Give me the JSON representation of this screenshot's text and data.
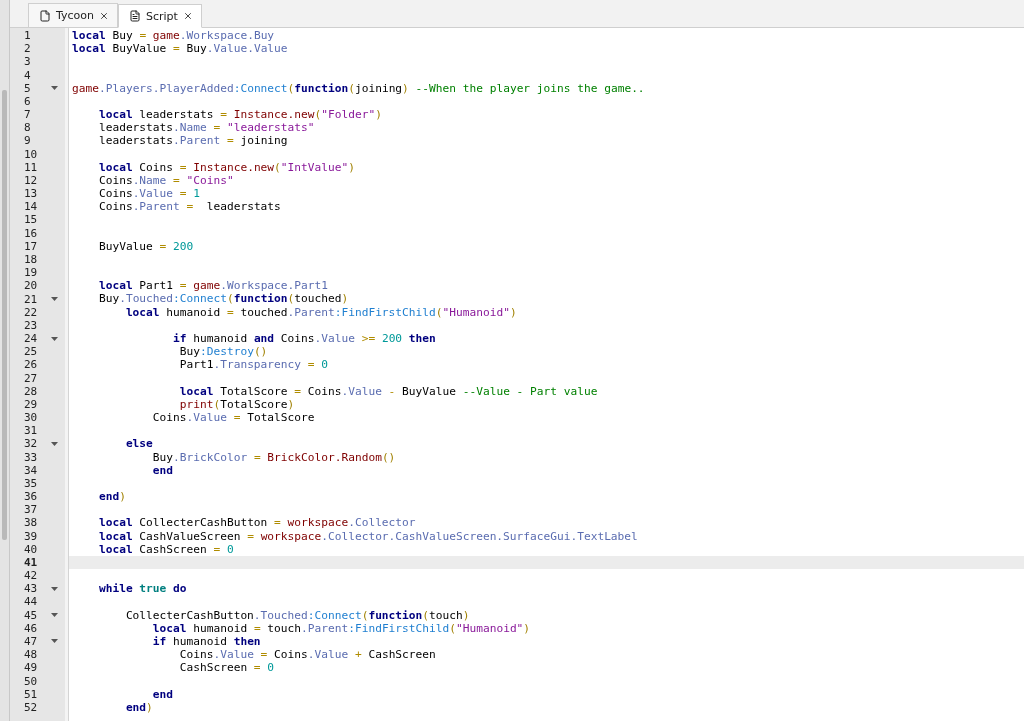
{
  "tabs": [
    {
      "label": "Tycoon",
      "kind": "place",
      "selected": false
    },
    {
      "label": "Script",
      "kind": "script",
      "selected": true
    }
  ],
  "lines": [
    {
      "number": "1",
      "fold": false,
      "current": false,
      "tokens": [
        {
          "kind": "keyword",
          "text": "local"
        },
        {
          "kind": "plain",
          "text": " Buy "
        },
        {
          "kind": "op",
          "text": "= "
        },
        {
          "kind": "global",
          "text": "game"
        },
        {
          "kind": "member",
          "text": ".Workspace.Buy"
        }
      ]
    },
    {
      "number": "2",
      "fold": false,
      "current": false,
      "tokens": [
        {
          "kind": "keyword",
          "text": "local"
        },
        {
          "kind": "plain",
          "text": " BuyValue "
        },
        {
          "kind": "op",
          "text": "="
        },
        {
          "kind": "plain",
          "text": " Buy"
        },
        {
          "kind": "member",
          "text": ".Value.Value"
        }
      ]
    },
    {
      "number": "3",
      "fold": false,
      "current": false
    },
    {
      "number": "4",
      "fold": false,
      "current": false
    },
    {
      "number": "5",
      "fold": true,
      "current": false,
      "tokens": [
        {
          "kind": "global",
          "text": "game"
        },
        {
          "kind": "member",
          "text": ".Players.PlayerAdded"
        },
        {
          "kind": "method",
          "text": ":Connect"
        },
        {
          "kind": "paren",
          "text": "("
        },
        {
          "kind": "keyword",
          "text": "function"
        },
        {
          "kind": "paren",
          "text": "("
        },
        {
          "kind": "plain",
          "text": "joining"
        },
        {
          "kind": "paren",
          "text": ") "
        },
        {
          "kind": "comment",
          "text": "--When the player joins the game.."
        }
      ]
    },
    {
      "number": "6",
      "fold": false,
      "current": false
    },
    {
      "number": "7",
      "fold": false,
      "current": false,
      "tokens": [
        {
          "kind": "keyword",
          "text": "    local"
        },
        {
          "kind": "plain",
          "text": " leaderstats "
        },
        {
          "kind": "op",
          "text": "= "
        },
        {
          "kind": "global",
          "text": "Instance.new"
        },
        {
          "kind": "paren",
          "text": "("
        },
        {
          "kind": "string",
          "text": "\"Folder\""
        },
        {
          "kind": "paren",
          "text": ")"
        }
      ]
    },
    {
      "number": "8",
      "fold": false,
      "current": false,
      "tokens": [
        {
          "kind": "plain",
          "text": "    leaderstats"
        },
        {
          "kind": "member",
          "text": ".Name"
        },
        {
          "kind": "op",
          "text": " = "
        },
        {
          "kind": "string",
          "text": "\"leaderstats\""
        }
      ]
    },
    {
      "number": "9",
      "fold": false,
      "current": false,
      "tokens": [
        {
          "kind": "plain",
          "text": "    leaderstats"
        },
        {
          "kind": "member",
          "text": ".Parent"
        },
        {
          "kind": "op",
          "text": " ="
        },
        {
          "kind": "plain",
          "text": " joining"
        }
      ]
    },
    {
      "number": "10",
      "fold": false,
      "current": false
    },
    {
      "number": "11",
      "fold": false,
      "current": false,
      "tokens": [
        {
          "kind": "keyword",
          "text": "    local"
        },
        {
          "kind": "plain",
          "text": " Coins "
        },
        {
          "kind": "op",
          "text": "= "
        },
        {
          "kind": "global",
          "text": "Instance.new"
        },
        {
          "kind": "paren",
          "text": "("
        },
        {
          "kind": "string",
          "text": "\"IntValue\""
        },
        {
          "kind": "paren",
          "text": ")"
        }
      ]
    },
    {
      "number": "12",
      "fold": false,
      "current": false,
      "tokens": [
        {
          "kind": "plain",
          "text": "    Coins"
        },
        {
          "kind": "member",
          "text": ".Name"
        },
        {
          "kind": "op",
          "text": " = "
        },
        {
          "kind": "string",
          "text": "\"Coins\""
        }
      ]
    },
    {
      "number": "13",
      "fold": false,
      "current": false,
      "tokens": [
        {
          "kind": "plain",
          "text": "    Coins"
        },
        {
          "kind": "member",
          "text": ".Value"
        },
        {
          "kind": "op",
          "text": " = "
        },
        {
          "kind": "number",
          "text": "1"
        }
      ]
    },
    {
      "number": "14",
      "fold": false,
      "current": false,
      "tokens": [
        {
          "kind": "plain",
          "text": "    Coins"
        },
        {
          "kind": "member",
          "text": ".Parent"
        },
        {
          "kind": "op",
          "text": " ="
        },
        {
          "kind": "plain",
          "text": "  leaderstats"
        }
      ]
    },
    {
      "number": "15",
      "fold": false,
      "current": false
    },
    {
      "number": "16",
      "fold": false,
      "current": false
    },
    {
      "number": "17",
      "fold": false,
      "current": false,
      "tokens": [
        {
          "kind": "plain",
          "text": "    BuyValue "
        },
        {
          "kind": "op",
          "text": "= "
        },
        {
          "kind": "number",
          "text": "200"
        }
      ]
    },
    {
      "number": "18",
      "fold": false,
      "current": false
    },
    {
      "number": "19",
      "fold": false,
      "current": false
    },
    {
      "number": "20",
      "fold": false,
      "current": false,
      "tokens": [
        {
          "kind": "keyword",
          "text": "    local"
        },
        {
          "kind": "plain",
          "text": " Part1 "
        },
        {
          "kind": "op",
          "text": "= "
        },
        {
          "kind": "global",
          "text": "game"
        },
        {
          "kind": "member",
          "text": ".Workspace.Part1"
        }
      ]
    },
    {
      "number": "21",
      "fold": true,
      "current": false,
      "tokens": [
        {
          "kind": "plain",
          "text": "    Buy"
        },
        {
          "kind": "member",
          "text": ".Touched"
        },
        {
          "kind": "method",
          "text": ":Connect"
        },
        {
          "kind": "paren",
          "text": "("
        },
        {
          "kind": "keyword",
          "text": "function"
        },
        {
          "kind": "paren",
          "text": "("
        },
        {
          "kind": "plain",
          "text": "touched"
        },
        {
          "kind": "paren",
          "text": ")"
        }
      ]
    },
    {
      "number": "22",
      "fold": false,
      "current": false,
      "tokens": [
        {
          "kind": "keyword",
          "text": "        local"
        },
        {
          "kind": "plain",
          "text": " humanoid "
        },
        {
          "kind": "op",
          "text": "="
        },
        {
          "kind": "plain",
          "text": " touched"
        },
        {
          "kind": "member",
          "text": ".Parent"
        },
        {
          "kind": "method",
          "text": ":FindFirstChild"
        },
        {
          "kind": "paren",
          "text": "("
        },
        {
          "kind": "string",
          "text": "\"Humanoid\""
        },
        {
          "kind": "paren",
          "text": ")"
        }
      ]
    },
    {
      "number": "23",
      "fold": false,
      "current": false
    },
    {
      "number": "24",
      "fold": true,
      "current": false,
      "tokens": [
        {
          "kind": "keyword",
          "text": "               if"
        },
        {
          "kind": "plain",
          "text": " humanoid "
        },
        {
          "kind": "keyword",
          "text": "and"
        },
        {
          "kind": "plain",
          "text": " Coins"
        },
        {
          "kind": "member",
          "text": ".Value"
        },
        {
          "kind": "op",
          "text": " >= "
        },
        {
          "kind": "number",
          "text": "200"
        },
        {
          "kind": "keyword",
          "text": " then"
        }
      ]
    },
    {
      "number": "25",
      "fold": false,
      "current": false,
      "tokens": [
        {
          "kind": "plain",
          "text": "                Buy"
        },
        {
          "kind": "method",
          "text": ":Destroy"
        },
        {
          "kind": "paren",
          "text": "()"
        }
      ]
    },
    {
      "number": "26",
      "fold": false,
      "current": false,
      "tokens": [
        {
          "kind": "plain",
          "text": "                Part1"
        },
        {
          "kind": "member",
          "text": ".Transparency"
        },
        {
          "kind": "op",
          "text": " = "
        },
        {
          "kind": "number",
          "text": "0"
        }
      ]
    },
    {
      "number": "27",
      "fold": false,
      "current": false
    },
    {
      "number": "28",
      "fold": false,
      "current": false,
      "tokens": [
        {
          "kind": "keyword",
          "text": "                local"
        },
        {
          "kind": "plain",
          "text": " TotalScore "
        },
        {
          "kind": "op",
          "text": "="
        },
        {
          "kind": "plain",
          "text": " Coins"
        },
        {
          "kind": "member",
          "text": ".Value"
        },
        {
          "kind": "op",
          "text": " -"
        },
        {
          "kind": "plain",
          "text": " BuyValue "
        },
        {
          "kind": "comment",
          "text": "--Value - Part value"
        }
      ]
    },
    {
      "number": "29",
      "fold": false,
      "current": false,
      "tokens": [
        {
          "kind": "global",
          "text": "                print"
        },
        {
          "kind": "paren",
          "text": "("
        },
        {
          "kind": "plain",
          "text": "TotalScore"
        },
        {
          "kind": "paren",
          "text": ")"
        }
      ]
    },
    {
      "number": "30",
      "fold": false,
      "current": false,
      "tokens": [
        {
          "kind": "plain",
          "text": "            Coins"
        },
        {
          "kind": "member",
          "text": ".Value"
        },
        {
          "kind": "op",
          "text": " ="
        },
        {
          "kind": "plain",
          "text": " TotalScore"
        }
      ]
    },
    {
      "number": "31",
      "fold": false,
      "current": false
    },
    {
      "number": "32",
      "fold": true,
      "current": false,
      "tokens": [
        {
          "kind": "keyword",
          "text": "        else"
        }
      ]
    },
    {
      "number": "33",
      "fold": false,
      "current": false,
      "tokens": [
        {
          "kind": "plain",
          "text": "            Buy"
        },
        {
          "kind": "member",
          "text": ".BrickColor"
        },
        {
          "kind": "op",
          "text": " = "
        },
        {
          "kind": "global",
          "text": "BrickColor.Random"
        },
        {
          "kind": "paren",
          "text": "()"
        }
      ]
    },
    {
      "number": "34",
      "fold": false,
      "current": false,
      "tokens": [
        {
          "kind": "keyword",
          "text": "            end"
        }
      ]
    },
    {
      "number": "35",
      "fold": false,
      "current": false
    },
    {
      "number": "36",
      "fold": false,
      "current": false,
      "tokens": [
        {
          "kind": "keyword",
          "text": "    end"
        },
        {
          "kind": "paren",
          "text": ")"
        }
      ]
    },
    {
      "number": "37",
      "fold": false,
      "current": false
    },
    {
      "number": "38",
      "fold": false,
      "current": false,
      "tokens": [
        {
          "kind": "keyword",
          "text": "    local"
        },
        {
          "kind": "plain",
          "text": " CollecterCashButton "
        },
        {
          "kind": "op",
          "text": "= "
        },
        {
          "kind": "global",
          "text": "workspace"
        },
        {
          "kind": "member",
          "text": ".Collector"
        }
      ]
    },
    {
      "number": "39",
      "fold": false,
      "current": false,
      "tokens": [
        {
          "kind": "keyword",
          "text": "    local"
        },
        {
          "kind": "plain",
          "text": " CashValueScreen "
        },
        {
          "kind": "op",
          "text": "= "
        },
        {
          "kind": "global",
          "text": "workspace"
        },
        {
          "kind": "member",
          "text": ".Collector.CashValueScreen.SurfaceGui.TextLabel"
        }
      ]
    },
    {
      "number": "40",
      "fold": false,
      "current": false,
      "tokens": [
        {
          "kind": "keyword",
          "text": "    local"
        },
        {
          "kind": "plain",
          "text": " CashScreen "
        },
        {
          "kind": "op",
          "text": "= "
        },
        {
          "kind": "number",
          "text": "0"
        }
      ]
    },
    {
      "number": "41",
      "fold": false,
      "current": true
    },
    {
      "number": "42",
      "fold": false,
      "current": false
    },
    {
      "number": "43",
      "fold": true,
      "current": false,
      "tokens": [
        {
          "kind": "keyword",
          "text": "    while"
        },
        {
          "kind": "literal",
          "text": " true"
        },
        {
          "kind": "keyword",
          "text": " do"
        }
      ]
    },
    {
      "number": "44",
      "fold": false,
      "current": false
    },
    {
      "number": "45",
      "fold": true,
      "current": false,
      "tokens": [
        {
          "kind": "plain",
          "text": "        CollecterCashButton"
        },
        {
          "kind": "member",
          "text": ".Touched"
        },
        {
          "kind": "method",
          "text": ":Connect"
        },
        {
          "kind": "paren",
          "text": "("
        },
        {
          "kind": "keyword",
          "text": "function"
        },
        {
          "kind": "paren",
          "text": "("
        },
        {
          "kind": "plain",
          "text": "touch"
        },
        {
          "kind": "paren",
          "text": ")"
        }
      ]
    },
    {
      "number": "46",
      "fold": false,
      "current": false,
      "tokens": [
        {
          "kind": "keyword",
          "text": "            local"
        },
        {
          "kind": "plain",
          "text": " humanoid "
        },
        {
          "kind": "op",
          "text": "="
        },
        {
          "kind": "plain",
          "text": " touch"
        },
        {
          "kind": "member",
          "text": ".Parent"
        },
        {
          "kind": "method",
          "text": ":FindFirstChild"
        },
        {
          "kind": "paren",
          "text": "("
        },
        {
          "kind": "string",
          "text": "\"Humanoid\""
        },
        {
          "kind": "paren",
          "text": ")"
        }
      ]
    },
    {
      "number": "47",
      "fold": true,
      "current": false,
      "tokens": [
        {
          "kind": "keyword",
          "text": "            if"
        },
        {
          "kind": "plain",
          "text": " humanoid "
        },
        {
          "kind": "keyword",
          "text": "then"
        }
      ]
    },
    {
      "number": "48",
      "fold": false,
      "current": false,
      "tokens": [
        {
          "kind": "plain",
          "text": "                Coins"
        },
        {
          "kind": "member",
          "text": ".Value"
        },
        {
          "kind": "op",
          "text": " ="
        },
        {
          "kind": "plain",
          "text": " Coins"
        },
        {
          "kind": "member",
          "text": ".Value"
        },
        {
          "kind": "op",
          "text": " +"
        },
        {
          "kind": "plain",
          "text": " CashScreen"
        }
      ]
    },
    {
      "number": "49",
      "fold": false,
      "current": false,
      "tokens": [
        {
          "kind": "plain",
          "text": "                CashScreen "
        },
        {
          "kind": "op",
          "text": "= "
        },
        {
          "kind": "number",
          "text": "0"
        }
      ]
    },
    {
      "number": "50",
      "fold": false,
      "current": false
    },
    {
      "number": "51",
      "fold": false,
      "current": false,
      "tokens": [
        {
          "kind": "keyword",
          "text": "            end"
        }
      ]
    },
    {
      "number": "52",
      "fold": false,
      "current": false,
      "tokens": [
        {
          "kind": "keyword",
          "text": "        end"
        },
        {
          "kind": "paren",
          "text": ")"
        }
      ]
    }
  ]
}
